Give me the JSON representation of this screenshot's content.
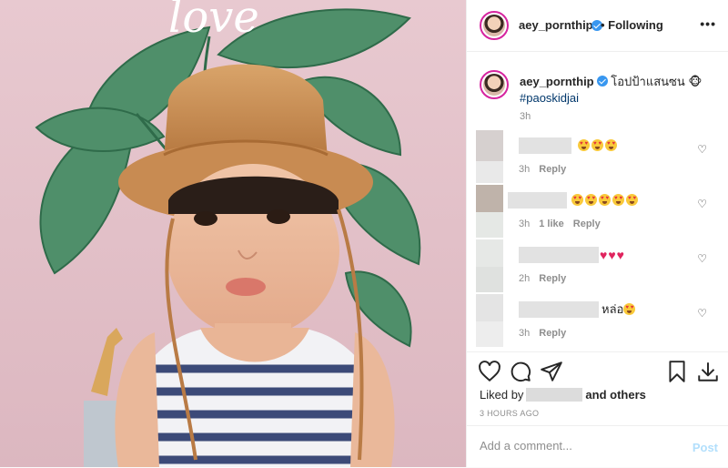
{
  "header": {
    "username": "aey_pornthip",
    "follow_status": "• Following",
    "more_icon": "more-horizontal-icon"
  },
  "photo": {
    "sign_text": "love"
  },
  "caption": {
    "username": "aey_pornthip",
    "text": "โอปป้าแสนซน 🐵",
    "hashtag": "#paoskidjai",
    "time": "3h"
  },
  "comments": [
    {
      "emoji_count": 3,
      "tail": "",
      "time": "3h",
      "likes": "",
      "reply": "Reply"
    },
    {
      "emoji_count": 5,
      "tail": "",
      "time": "3h",
      "likes": "1 like",
      "reply": "Reply"
    },
    {
      "hearts": 3,
      "tail": "",
      "time": "2h",
      "likes": "",
      "reply": "Reply"
    },
    {
      "text": "หล่อ",
      "emoji_count": 1,
      "time": "3h",
      "likes": "",
      "reply": "Reply"
    }
  ],
  "actions": {
    "liked_by_prefix": "Liked by",
    "liked_by_suffix": "and others",
    "time_ago": "3 HOURS AGO",
    "icons": [
      "heart-icon",
      "comment-icon",
      "share-icon",
      "bookmark-icon",
      "download-icon"
    ]
  },
  "add_comment": {
    "placeholder": "Add a comment...",
    "post_label": "Post"
  },
  "colors": {
    "verified": "#3897f0",
    "link": "#00376b",
    "post_disabled": "#b2dffc",
    "muted": "#8e8e8e"
  }
}
